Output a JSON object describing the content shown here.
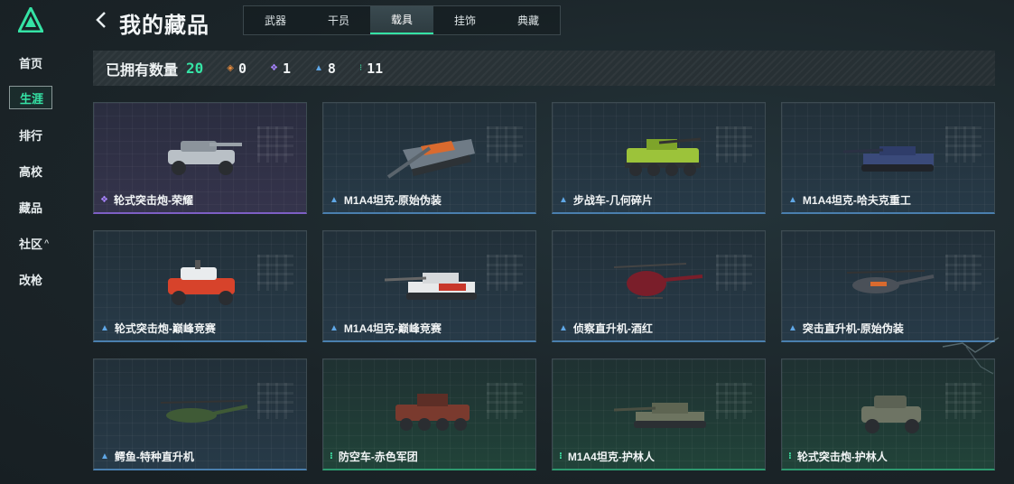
{
  "sidebar": {
    "items": [
      {
        "label": "首页"
      },
      {
        "label": "生涯"
      },
      {
        "label": "排行"
      },
      {
        "label": "高校"
      },
      {
        "label": "藏品"
      },
      {
        "label": "社区",
        "caret": "^"
      },
      {
        "label": "改枪"
      }
    ],
    "active_index": 1
  },
  "header": {
    "title": "我的藏品",
    "tabs": [
      "武器",
      "干员",
      "载具",
      "挂饰",
      "典藏"
    ],
    "active_tab_index": 2
  },
  "stats": {
    "owned_label": "已拥有数量",
    "owned_count": "20",
    "rarity_counts": [
      {
        "color": "#e88b3c",
        "count": "0"
      },
      {
        "color": "#a884ff",
        "count": "1"
      },
      {
        "color": "#5fa7e6",
        "count": "8"
      },
      {
        "color": "#3ee0a2",
        "count": "11"
      }
    ]
  },
  "items": [
    {
      "name": "轮式突击炮-荣耀",
      "rarity": "purple"
    },
    {
      "name": "M1A4坦克-原始伪装",
      "rarity": "blue"
    },
    {
      "name": "步战车-几何碎片",
      "rarity": "blue"
    },
    {
      "name": "M1A4坦克-哈夫克重工",
      "rarity": "blue"
    },
    {
      "name": "轮式突击炮-巅峰竞赛",
      "rarity": "blue"
    },
    {
      "name": "M1A4坦克-巅峰竞赛",
      "rarity": "blue"
    },
    {
      "name": "侦察直升机-酒红",
      "rarity": "blue"
    },
    {
      "name": "突击直升机-原始伪装",
      "rarity": "blue"
    },
    {
      "name": "鳄鱼-特种直升机",
      "rarity": "blue"
    },
    {
      "name": "防空车-赤色军团",
      "rarity": "green"
    },
    {
      "name": "M1A4坦克-护林人",
      "rarity": "green"
    },
    {
      "name": "轮式突击炮-护林人",
      "rarity": "green"
    }
  ],
  "colors": {
    "accent": "#35e3a5",
    "purple": "#a884ff",
    "blue": "#5fa7e6",
    "green": "#3ee0a2",
    "orange": "#e88b3c"
  }
}
